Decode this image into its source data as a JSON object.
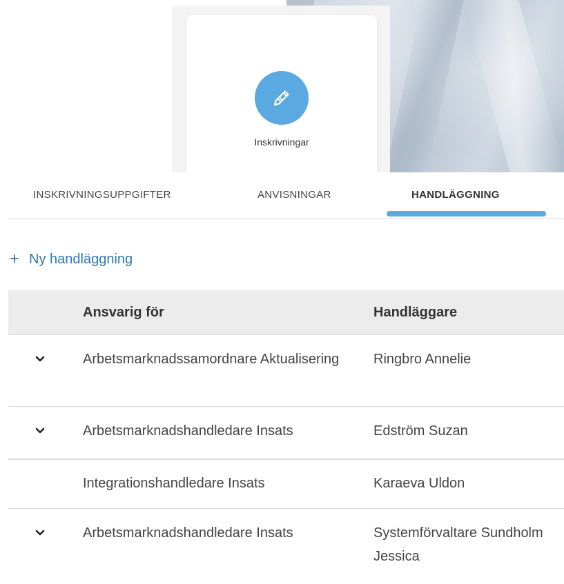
{
  "card": {
    "label": "Inskrivningar",
    "icon": "pencil-icon"
  },
  "tabs": [
    {
      "label": "INSKRIVNINGSUPPGIFTER",
      "active": false
    },
    {
      "label": "ANVISNINGAR",
      "active": false
    },
    {
      "label": "HANDLÄGGNING",
      "active": true
    }
  ],
  "new_button": {
    "label": "Ny handläggning",
    "icon": "plus-icon"
  },
  "table": {
    "headers": [
      "Ansvarig för",
      "Handläggare"
    ],
    "rows": [
      {
        "expandable": true,
        "responsible": "Arbetsmarknadssamordnare Aktualisering",
        "handler": "Ringbro Annelie"
      },
      {
        "expandable": true,
        "responsible": "Arbetsmarknadshandledare Insats",
        "handler": "Edström Suzan"
      },
      {
        "expandable": false,
        "responsible": "Integrationshandledare Insats",
        "handler": "Karaeva Uldon"
      },
      {
        "expandable": true,
        "responsible": "Arbetsmarknadshandledare Insats",
        "handler": "Systemförvaltare Sundholm Jessica"
      }
    ]
  },
  "colors": {
    "accent": "#5aa9e0",
    "link": "#2f78b7"
  }
}
